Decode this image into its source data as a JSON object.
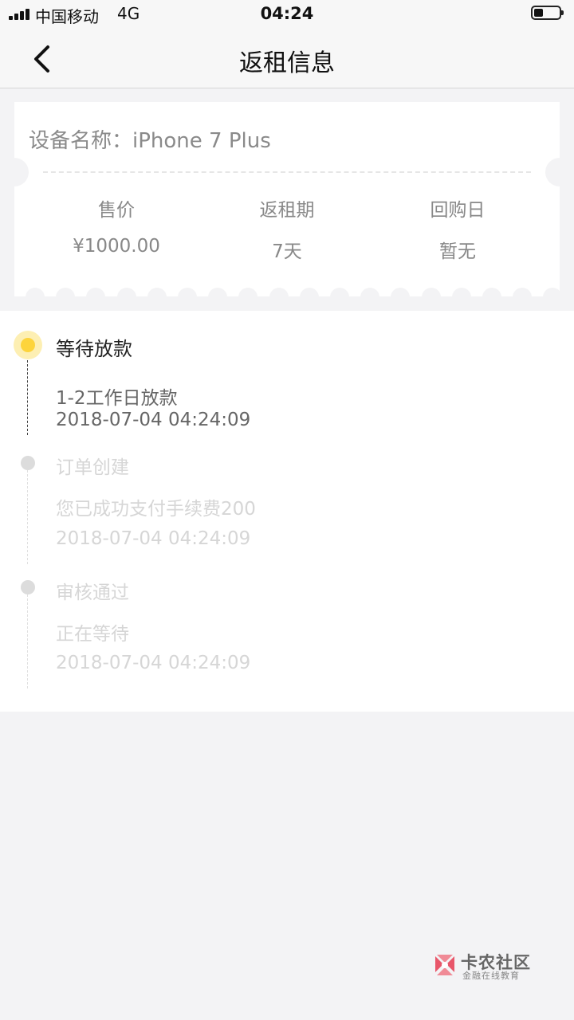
{
  "status_bar": {
    "carrier": "中国移动",
    "network": "4G",
    "time": "04:24",
    "signal_bars": 4,
    "battery_level": 0.35
  },
  "nav": {
    "title": "返租信息",
    "back_icon": "chevron-left-icon"
  },
  "device": {
    "label": "设备名称：",
    "name": "iPhone 7 Plus",
    "columns": [
      {
        "label": "售价",
        "value": "¥1000.00"
      },
      {
        "label": "返租期",
        "value": "7天"
      },
      {
        "label": "回购日",
        "value": "暂无"
      }
    ]
  },
  "timeline": [
    {
      "title": "等待放款",
      "detail": "1-2工作日放款",
      "time": "2018-07-04 04:24:09",
      "active": true
    },
    {
      "title": "订单创建",
      "detail": "您已成功支付手续费200",
      "time": "2018-07-04 04:24:09",
      "active": false
    },
    {
      "title": "审核通过",
      "detail": "正在等待",
      "time": "2018-07-04 04:24:09",
      "active": false
    }
  ],
  "watermark": {
    "name": "卡农社区",
    "tagline": "金融在线教育"
  },
  "colors": {
    "accent": "#fdd43c",
    "accent_halo": "#fdefb3",
    "background": "#f3f3f5"
  }
}
